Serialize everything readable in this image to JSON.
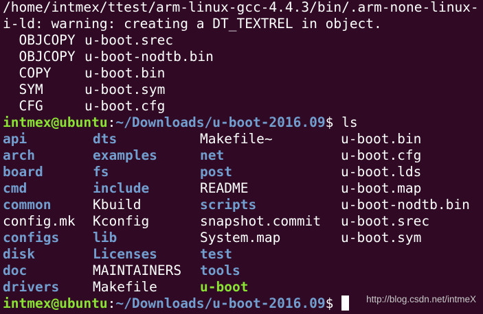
{
  "colors": {
    "background": "#300a24",
    "text": "#ffffff",
    "directory": "#729fcf",
    "executable": "#8ae234",
    "prompt_user": "#8ae234",
    "prompt_path": "#729fcf"
  },
  "build_output": {
    "line1": "/home/intmex/ttest/arm-linux-gcc-4.4.3/bin/.arm-none-linux-",
    "line2": "i-ld: warning: creating a DT_TEXTREL in object.",
    "steps": [
      {
        "cmd": "  OBJCOPY",
        "target": "u-boot.srec"
      },
      {
        "cmd": "  OBJCOPY",
        "target": "u-boot-nodtb.bin"
      },
      {
        "cmd": "  COPY",
        "target": "u-boot.bin"
      },
      {
        "cmd": "  SYM",
        "target": "u-boot.sym"
      },
      {
        "cmd": "  CFG",
        "target": "u-boot.cfg"
      }
    ]
  },
  "prompt": {
    "user_host": "intmex@ubuntu",
    "separator": ":",
    "path": "~/Downloads/u-boot-2016.09",
    "symbol": "$ ",
    "command": "ls"
  },
  "listing": {
    "rows": [
      [
        {
          "name": "api",
          "kind": "dir"
        },
        {
          "name": "dts",
          "kind": "dir"
        },
        {
          "name": "Makefile~",
          "kind": "file"
        },
        {
          "name": "u-boot.bin",
          "kind": "file"
        }
      ],
      [
        {
          "name": "arch",
          "kind": "dir"
        },
        {
          "name": "examples",
          "kind": "dir"
        },
        {
          "name": "net",
          "kind": "dir"
        },
        {
          "name": "u-boot.cfg",
          "kind": "file"
        }
      ],
      [
        {
          "name": "board",
          "kind": "dir"
        },
        {
          "name": "fs",
          "kind": "dir"
        },
        {
          "name": "post",
          "kind": "dir"
        },
        {
          "name": "u-boot.lds",
          "kind": "file"
        }
      ],
      [
        {
          "name": "cmd",
          "kind": "dir"
        },
        {
          "name": "include",
          "kind": "dir"
        },
        {
          "name": "README",
          "kind": "file"
        },
        {
          "name": "u-boot.map",
          "kind": "file"
        }
      ],
      [
        {
          "name": "common",
          "kind": "dir"
        },
        {
          "name": "Kbuild",
          "kind": "file"
        },
        {
          "name": "scripts",
          "kind": "dir"
        },
        {
          "name": "u-boot-nodtb.bin",
          "kind": "file"
        }
      ],
      [
        {
          "name": "config.mk",
          "kind": "file"
        },
        {
          "name": "Kconfig",
          "kind": "file"
        },
        {
          "name": "snapshot.commit",
          "kind": "file"
        },
        {
          "name": "u-boot.srec",
          "kind": "file"
        }
      ],
      [
        {
          "name": "configs",
          "kind": "dir"
        },
        {
          "name": "lib",
          "kind": "dir"
        },
        {
          "name": "System.map",
          "kind": "file"
        },
        {
          "name": "u-boot.sym",
          "kind": "file"
        }
      ],
      [
        {
          "name": "disk",
          "kind": "dir"
        },
        {
          "name": "Licenses",
          "kind": "dir"
        },
        {
          "name": "test",
          "kind": "dir"
        },
        {
          "name": "",
          "kind": "file"
        }
      ],
      [
        {
          "name": "doc",
          "kind": "dir"
        },
        {
          "name": "MAINTAINERS",
          "kind": "file"
        },
        {
          "name": "tools",
          "kind": "dir"
        },
        {
          "name": "",
          "kind": "file"
        }
      ],
      [
        {
          "name": "drivers",
          "kind": "dir"
        },
        {
          "name": "Makefile",
          "kind": "file"
        },
        {
          "name": "u-boot",
          "kind": "exe"
        },
        {
          "name": "",
          "kind": "file"
        }
      ]
    ]
  },
  "final_prompt": {
    "user_host": "intmex@ubuntu",
    "separator": ":",
    "path": "~/Downloads/u-boot-2016.09",
    "symbol": "$ "
  },
  "watermark": "http://blog.csdn.net/intmeX"
}
